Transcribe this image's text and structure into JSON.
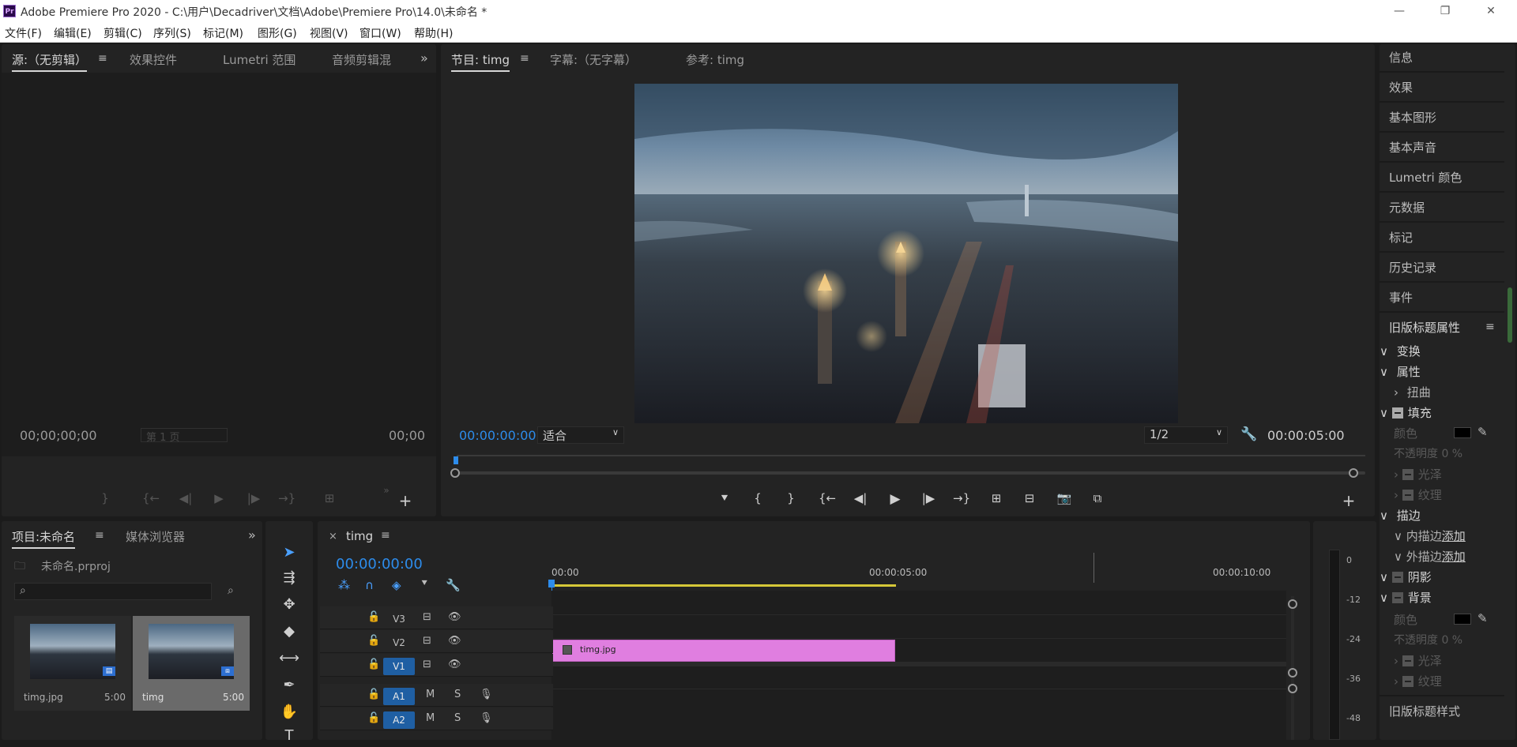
{
  "window": {
    "title": "Adobe Premiere Pro 2020 - C:\\用户\\Decadriver\\文档\\Adobe\\Premiere Pro\\14.0\\未命名 *",
    "logo_text": "Pr",
    "minimize": "—",
    "restore": "❐",
    "close": "✕"
  },
  "menu": [
    "文件(F)",
    "编辑(E)",
    "剪辑(C)",
    "序列(S)",
    "标记(M)",
    "图形(G)",
    "视图(V)",
    "窗口(W)",
    "帮助(H)"
  ],
  "source_panel": {
    "tabs": [
      "源:（无剪辑）",
      "效果控件",
      "Lumetri 范围",
      "音频剪辑混"
    ],
    "timecode_left": "00;00;00;00",
    "page": "第 1 页",
    "timecode_right": "00;00"
  },
  "program_panel": {
    "tabs": [
      "节目: timg",
      "字幕:（无字幕）",
      "参考: timg"
    ],
    "timecode_left": "00:00:00:00",
    "fit": "适合",
    "resolution": "1/2",
    "timecode_right": "00:00:05:00"
  },
  "project_panel": {
    "tabs": [
      "项目:未命名",
      "媒体浏览器"
    ],
    "file": "未命名.prproj",
    "items": [
      {
        "name": "timg.jpg",
        "duration": "5:00"
      },
      {
        "name": "timg",
        "duration": "5:00"
      }
    ]
  },
  "timeline": {
    "tab": "timg",
    "timecode": "00:00:00:00",
    "ruler": [
      "00:00",
      "00:00:05:00",
      "00:00:10:00"
    ],
    "tracks_video": [
      "V3",
      "V2",
      "V1"
    ],
    "tracks_audio": [
      "A1",
      "A2"
    ],
    "mute": "M",
    "solo": "S",
    "clip_name": "timg.jpg",
    "clip_color": "#e07ee0"
  },
  "meter": {
    "scale": [
      "0",
      "-12",
      "-24",
      "-36",
      "-48"
    ]
  },
  "right_panel": {
    "items": [
      "信息",
      "效果",
      "基本图形",
      "基本声音",
      "Lumetri 颜色",
      "元数据",
      "标记",
      "历史记录",
      "事件",
      "旧版标题属性"
    ],
    "props": {
      "transform": "变换",
      "attributes": "属性",
      "distort": "扭曲",
      "fill": "填充",
      "color": "颜色",
      "opacity": "不透明度",
      "opacity_val": "0 %",
      "sheen": "光泽",
      "texture": "纹理",
      "stroke": "描边",
      "inner_stroke": "内描边",
      "outer_stroke": "外描边",
      "add": "添加",
      "shadow": "阴影",
      "background": "背景"
    },
    "bottom": "旧版标题样式"
  }
}
